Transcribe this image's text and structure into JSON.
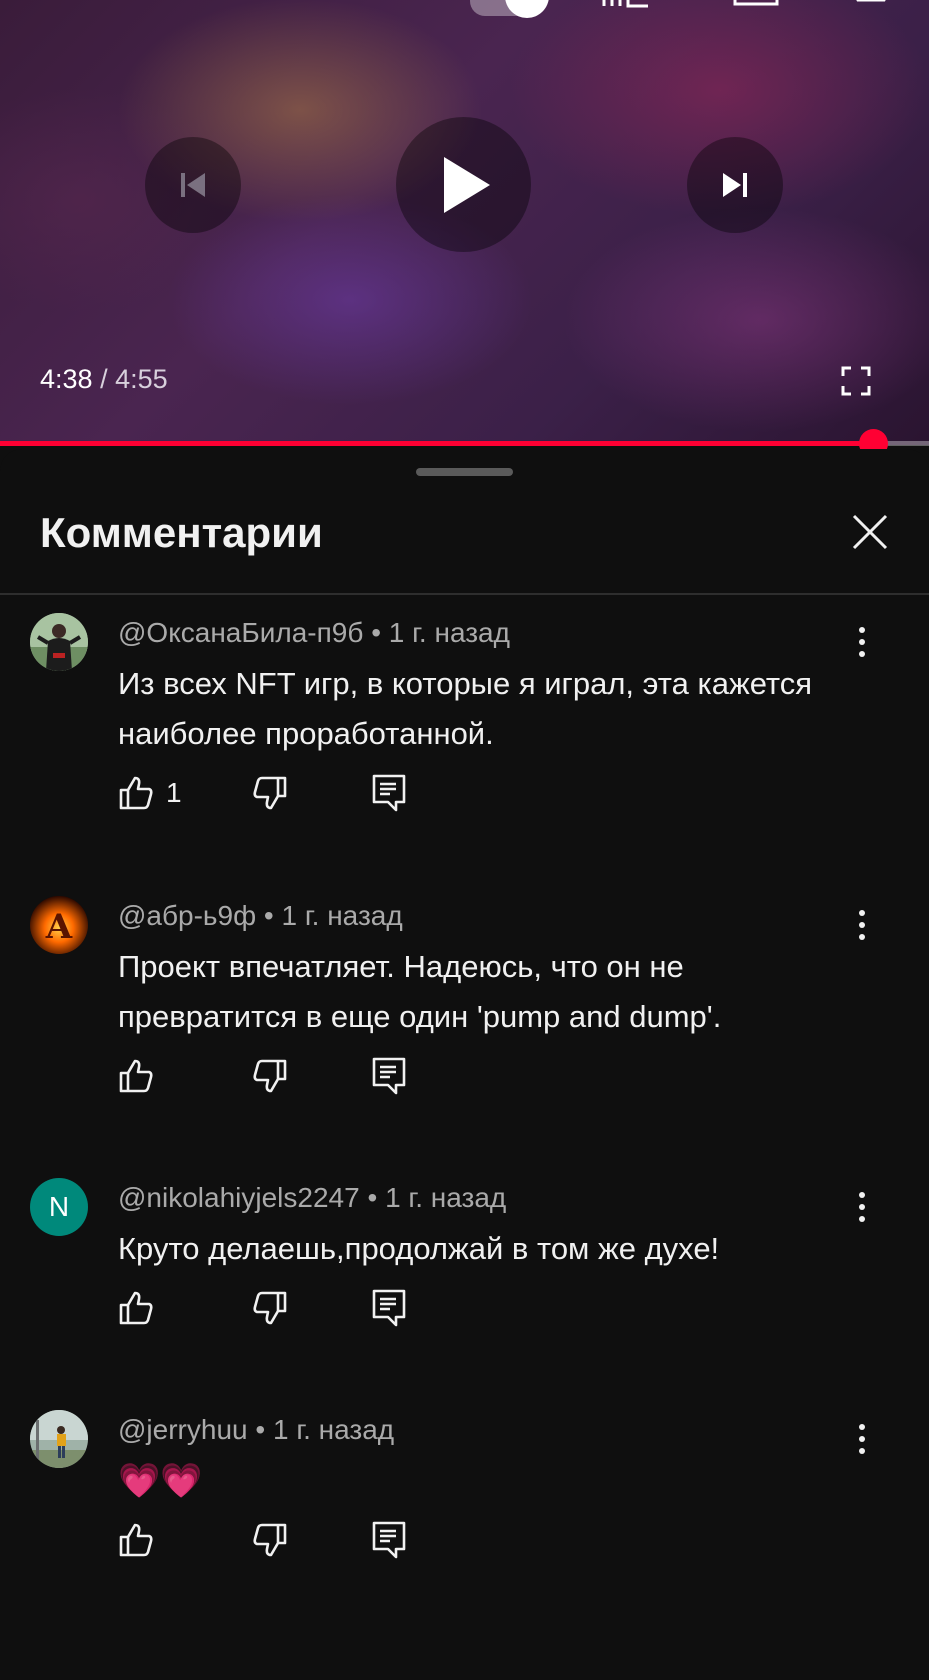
{
  "player": {
    "current_time": "4:38",
    "separator": "/",
    "duration": "4:55",
    "progress_fraction": 0.94,
    "accent_color": "#ff0033"
  },
  "comments_panel": {
    "title": "Комментарии",
    "close_icon": "close-icon"
  },
  "comments": [
    {
      "author": "@ОксанаБила-п9б",
      "time": "1 г. назад",
      "text": "Из всех NFT игр, в которые я играл, эта кажется наиболее проработанной.",
      "likes": "1",
      "avatar_kind": "photo-person"
    },
    {
      "author": "@абр-ь9ф",
      "time": "1 г. назад",
      "text": "Проект впечатляет. Надеюсь, что он не превратится в еще один 'pump and dump'.",
      "likes": "",
      "avatar_letter": "A",
      "avatar_kind": "fire-letter"
    },
    {
      "author": "@nikolahiyjels2247",
      "time": "1 г. назад",
      "text": "Круто делаешь,продолжай в том же духе!",
      "likes": "",
      "avatar_letter": "N",
      "avatar_kind": "letter",
      "avatar_color": "#00897b"
    },
    {
      "author": "@jerryhuu",
      "time": "1 г. назад",
      "text": "💗💗",
      "likes": "",
      "avatar_kind": "photo-outdoor"
    }
  ],
  "icons": {
    "like": "thumbs-up-icon",
    "dislike": "thumbs-down-icon",
    "reply": "reply-icon",
    "more": "more-vert-icon"
  }
}
